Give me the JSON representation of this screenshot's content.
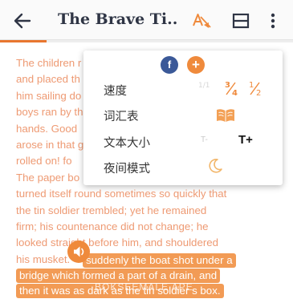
{
  "header": {
    "title": "The Brave Ti...",
    "icons": [
      "back-arrow-icon",
      "translate-icon",
      "layout-icon",
      "more-vert-icon"
    ],
    "progress_fraction": 0.16
  },
  "reader": {
    "lines": [
      "The children r",
      "and placed th",
      "him sailing do",
      "boys ran by th",
      "hands.   Good",
      "arose in that g",
      "rolled on!      fo",
      "The paper bo",
      "turned itself round sometimes so quickly that",
      "the tin soldier trembled;          yet he remained",
      "firm;      his countenance did not change;         he",
      "looked straight before him, and shouldered"
    ],
    "highlighted": [
      "suddenly the boat shot under a",
      "bridge which formed a part of a drain, and",
      "then it was as dark as the tin soldier s box."
    ],
    "line_after_speaker": "his musket.",
    "watermark": "BOKSEEMALE APE"
  },
  "menu": {
    "share": {
      "facebook": "f",
      "more": "+"
    },
    "speed_label": "速度",
    "vocab_label": "词汇表",
    "text_size_label": "文本大小",
    "text_size_small": "T-",
    "text_size_large": "T+",
    "night_label": "夜间模式",
    "speed_options": [
      "1/1",
      "3/4",
      "1/2"
    ]
  },
  "colors": {
    "accent": "#ef8a3c",
    "title": "#2f3545",
    "faded_text": "#ee9a73",
    "facebook": "#3b5998"
  }
}
